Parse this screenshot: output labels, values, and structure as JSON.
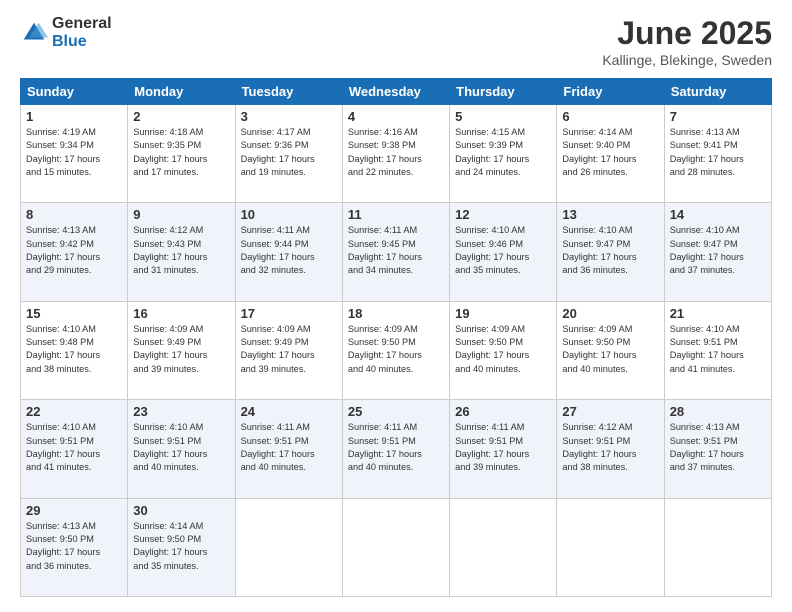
{
  "logo": {
    "general": "General",
    "blue": "Blue"
  },
  "header": {
    "month_year": "June 2025",
    "location": "Kallinge, Blekinge, Sweden"
  },
  "weekdays": [
    "Sunday",
    "Monday",
    "Tuesday",
    "Wednesday",
    "Thursday",
    "Friday",
    "Saturday"
  ],
  "weeks": [
    [
      {
        "day": "1",
        "lines": [
          "Sunrise: 4:19 AM",
          "Sunset: 9:34 PM",
          "Daylight: 17 hours",
          "and 15 minutes."
        ]
      },
      {
        "day": "2",
        "lines": [
          "Sunrise: 4:18 AM",
          "Sunset: 9:35 PM",
          "Daylight: 17 hours",
          "and 17 minutes."
        ]
      },
      {
        "day": "3",
        "lines": [
          "Sunrise: 4:17 AM",
          "Sunset: 9:36 PM",
          "Daylight: 17 hours",
          "and 19 minutes."
        ]
      },
      {
        "day": "4",
        "lines": [
          "Sunrise: 4:16 AM",
          "Sunset: 9:38 PM",
          "Daylight: 17 hours",
          "and 22 minutes."
        ]
      },
      {
        "day": "5",
        "lines": [
          "Sunrise: 4:15 AM",
          "Sunset: 9:39 PM",
          "Daylight: 17 hours",
          "and 24 minutes."
        ]
      },
      {
        "day": "6",
        "lines": [
          "Sunrise: 4:14 AM",
          "Sunset: 9:40 PM",
          "Daylight: 17 hours",
          "and 26 minutes."
        ]
      },
      {
        "day": "7",
        "lines": [
          "Sunrise: 4:13 AM",
          "Sunset: 9:41 PM",
          "Daylight: 17 hours",
          "and 28 minutes."
        ]
      }
    ],
    [
      {
        "day": "8",
        "lines": [
          "Sunrise: 4:13 AM",
          "Sunset: 9:42 PM",
          "Daylight: 17 hours",
          "and 29 minutes."
        ]
      },
      {
        "day": "9",
        "lines": [
          "Sunrise: 4:12 AM",
          "Sunset: 9:43 PM",
          "Daylight: 17 hours",
          "and 31 minutes."
        ]
      },
      {
        "day": "10",
        "lines": [
          "Sunrise: 4:11 AM",
          "Sunset: 9:44 PM",
          "Daylight: 17 hours",
          "and 32 minutes."
        ]
      },
      {
        "day": "11",
        "lines": [
          "Sunrise: 4:11 AM",
          "Sunset: 9:45 PM",
          "Daylight: 17 hours",
          "and 34 minutes."
        ]
      },
      {
        "day": "12",
        "lines": [
          "Sunrise: 4:10 AM",
          "Sunset: 9:46 PM",
          "Daylight: 17 hours",
          "and 35 minutes."
        ]
      },
      {
        "day": "13",
        "lines": [
          "Sunrise: 4:10 AM",
          "Sunset: 9:47 PM",
          "Daylight: 17 hours",
          "and 36 minutes."
        ]
      },
      {
        "day": "14",
        "lines": [
          "Sunrise: 4:10 AM",
          "Sunset: 9:47 PM",
          "Daylight: 17 hours",
          "and 37 minutes."
        ]
      }
    ],
    [
      {
        "day": "15",
        "lines": [
          "Sunrise: 4:10 AM",
          "Sunset: 9:48 PM",
          "Daylight: 17 hours",
          "and 38 minutes."
        ]
      },
      {
        "day": "16",
        "lines": [
          "Sunrise: 4:09 AM",
          "Sunset: 9:49 PM",
          "Daylight: 17 hours",
          "and 39 minutes."
        ]
      },
      {
        "day": "17",
        "lines": [
          "Sunrise: 4:09 AM",
          "Sunset: 9:49 PM",
          "Daylight: 17 hours",
          "and 39 minutes."
        ]
      },
      {
        "day": "18",
        "lines": [
          "Sunrise: 4:09 AM",
          "Sunset: 9:50 PM",
          "Daylight: 17 hours",
          "and 40 minutes."
        ]
      },
      {
        "day": "19",
        "lines": [
          "Sunrise: 4:09 AM",
          "Sunset: 9:50 PM",
          "Daylight: 17 hours",
          "and 40 minutes."
        ]
      },
      {
        "day": "20",
        "lines": [
          "Sunrise: 4:09 AM",
          "Sunset: 9:50 PM",
          "Daylight: 17 hours",
          "and 40 minutes."
        ]
      },
      {
        "day": "21",
        "lines": [
          "Sunrise: 4:10 AM",
          "Sunset: 9:51 PM",
          "Daylight: 17 hours",
          "and 41 minutes."
        ]
      }
    ],
    [
      {
        "day": "22",
        "lines": [
          "Sunrise: 4:10 AM",
          "Sunset: 9:51 PM",
          "Daylight: 17 hours",
          "and 41 minutes."
        ]
      },
      {
        "day": "23",
        "lines": [
          "Sunrise: 4:10 AM",
          "Sunset: 9:51 PM",
          "Daylight: 17 hours",
          "and 40 minutes."
        ]
      },
      {
        "day": "24",
        "lines": [
          "Sunrise: 4:11 AM",
          "Sunset: 9:51 PM",
          "Daylight: 17 hours",
          "and 40 minutes."
        ]
      },
      {
        "day": "25",
        "lines": [
          "Sunrise: 4:11 AM",
          "Sunset: 9:51 PM",
          "Daylight: 17 hours",
          "and 40 minutes."
        ]
      },
      {
        "day": "26",
        "lines": [
          "Sunrise: 4:11 AM",
          "Sunset: 9:51 PM",
          "Daylight: 17 hours",
          "and 39 minutes."
        ]
      },
      {
        "day": "27",
        "lines": [
          "Sunrise: 4:12 AM",
          "Sunset: 9:51 PM",
          "Daylight: 17 hours",
          "and 38 minutes."
        ]
      },
      {
        "day": "28",
        "lines": [
          "Sunrise: 4:13 AM",
          "Sunset: 9:51 PM",
          "Daylight: 17 hours",
          "and 37 minutes."
        ]
      }
    ],
    [
      {
        "day": "29",
        "lines": [
          "Sunrise: 4:13 AM",
          "Sunset: 9:50 PM",
          "Daylight: 17 hours",
          "and 36 minutes."
        ]
      },
      {
        "day": "30",
        "lines": [
          "Sunrise: 4:14 AM",
          "Sunset: 9:50 PM",
          "Daylight: 17 hours",
          "and 35 minutes."
        ]
      },
      {
        "day": "",
        "lines": []
      },
      {
        "day": "",
        "lines": []
      },
      {
        "day": "",
        "lines": []
      },
      {
        "day": "",
        "lines": []
      },
      {
        "day": "",
        "lines": []
      }
    ]
  ]
}
